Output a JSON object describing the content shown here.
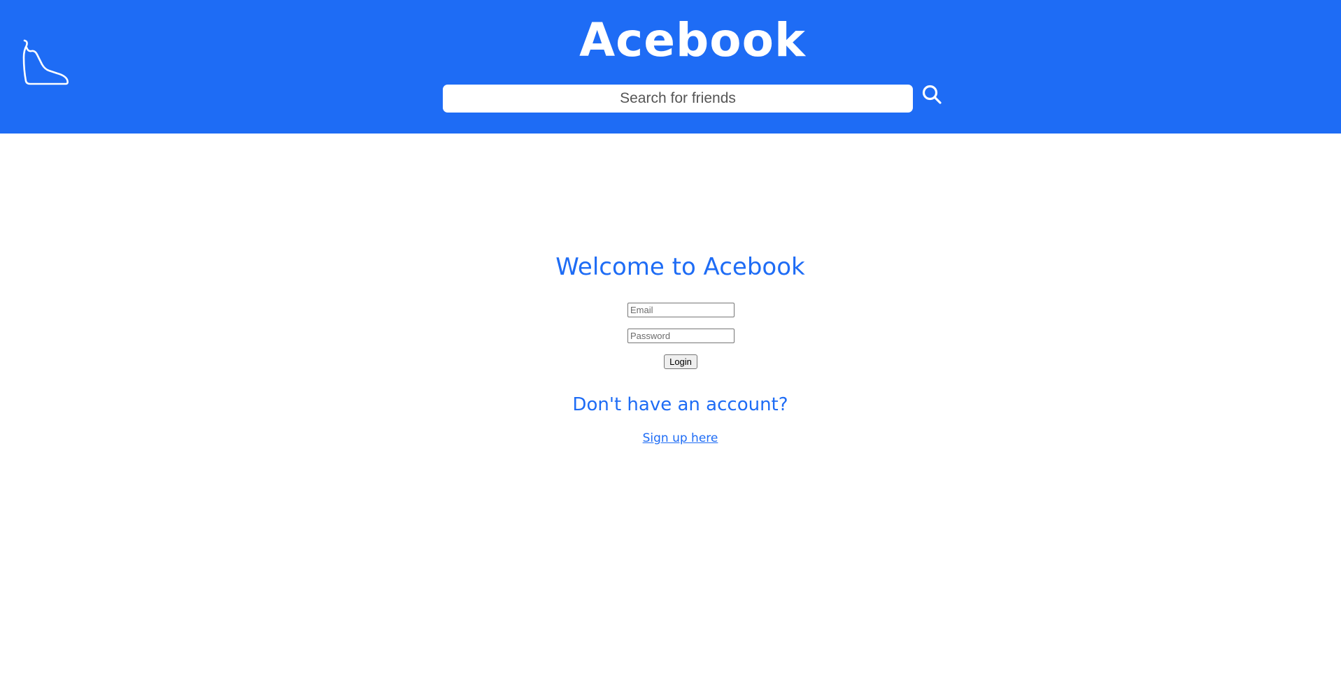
{
  "header": {
    "title": "Acebook",
    "logo_icon": "shoe-icon",
    "search": {
      "placeholder": "Search for friends",
      "value": "",
      "button_icon": "search-icon"
    }
  },
  "main": {
    "welcome": "Welcome to Acebook",
    "email_placeholder": "Email",
    "password_placeholder": "Password",
    "login_label": "Login",
    "no_account": "Don't have an account?",
    "signup_label": "Sign up here"
  },
  "colors": {
    "brand": "#1e6cf5",
    "header_text": "#ffffff",
    "background": "#ffffff"
  }
}
